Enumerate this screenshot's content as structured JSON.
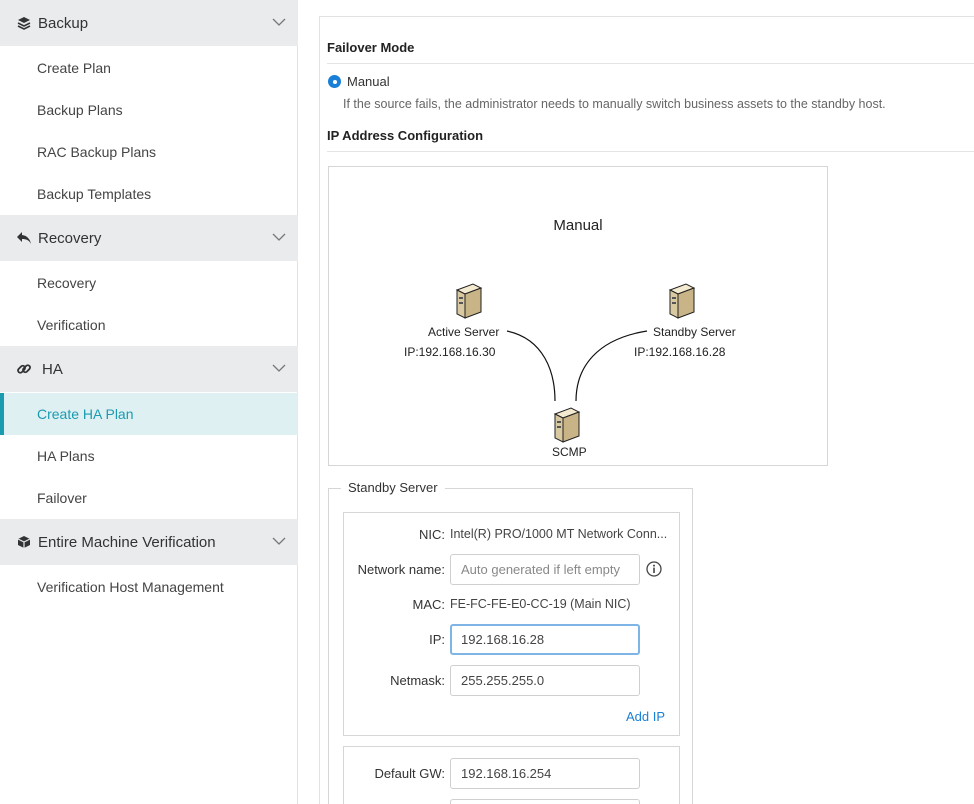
{
  "sidebar": {
    "groups": [
      {
        "label": "Backup",
        "icon": "layers-icon",
        "items": [
          "Create Plan",
          "Backup Plans",
          "RAC Backup Plans",
          "Backup Templates"
        ]
      },
      {
        "label": "Recovery",
        "icon": "reply-arrow-icon",
        "items": [
          "Recovery",
          "Verification"
        ]
      },
      {
        "label": "HA",
        "icon": "link-icon",
        "items": [
          "Create HA Plan",
          "HA Plans",
          "Failover"
        ]
      },
      {
        "label": "Entire Machine Verification",
        "icon": "cube-icon",
        "items": [
          "Verification Host Management"
        ]
      }
    ],
    "active_item": "Create HA Plan"
  },
  "main": {
    "failover_title": "Failover Mode",
    "radio_label": "Manual",
    "radio_desc": "If the source fails, the administrator needs to manually switch business assets to the standby host.",
    "ip_config_title": "IP Address Configuration",
    "diagram": {
      "title": "Manual",
      "active_label": "Active Server",
      "active_ip": "IP:192.168.16.30",
      "standby_label": "Standby Server",
      "standby_ip": "IP:192.168.16.28",
      "scmp_label": "SCMP"
    },
    "standby": {
      "legend": "Standby Server",
      "nic_label": "NIC:",
      "nic_value": "Intel(R) PRO/1000 MT Network Conn...",
      "network_name_label": "Network name:",
      "network_name_placeholder": "Auto generated if left empty",
      "mac_label": "MAC:",
      "mac_value": "FE-FC-FE-E0-CC-19 (Main NIC)",
      "ip_label": "IP:",
      "ip_value": "192.168.16.28",
      "netmask_label": "Netmask:",
      "netmask_value": "255.255.255.0",
      "add_ip": "Add IP",
      "gw_label": "Default GW:",
      "gw_value": "192.168.16.254"
    }
  },
  "colors": {
    "accent": "#1a9bb0",
    "link": "#1a7fd6",
    "sidebar_header": "#e9ebed",
    "active_bg": "#dff0f3"
  }
}
